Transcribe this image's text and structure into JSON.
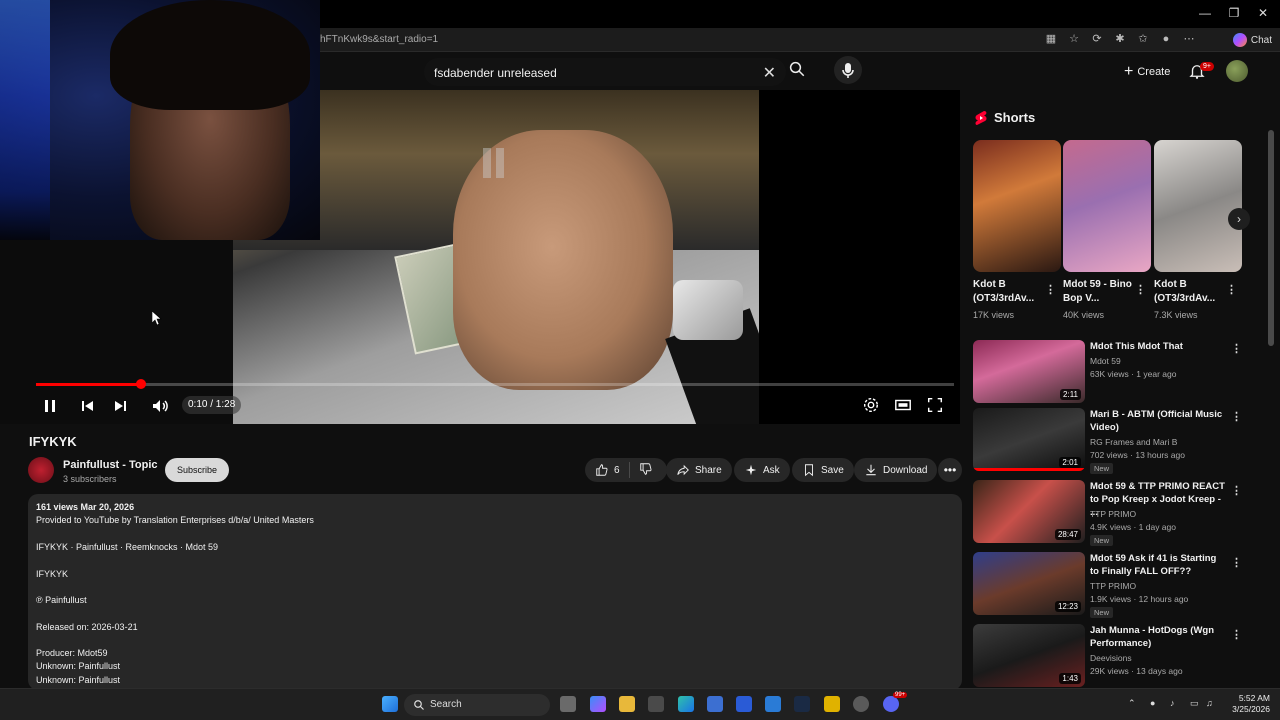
{
  "browser": {
    "url": "hFTnKwk9s&start_radio=1",
    "chat_label": "Chat"
  },
  "topbar": {
    "search_value": "fsdabender unreleased",
    "create_label": "Create",
    "notif_count": "9+"
  },
  "player": {
    "time": "0:10 / 1:28",
    "progress": 0.114
  },
  "video": {
    "title": "IFYKYK",
    "channel": "Painfullust - Topic",
    "subs": "3 subscribers",
    "subscribe": "Subscribe",
    "likes": "6",
    "share": "Share",
    "ask": "Ask",
    "save": "Save",
    "download": "Download"
  },
  "description": {
    "stats": "161 views  Mar 20, 2026",
    "lines": [
      "Provided to YouTube by Translation Enterprises d/b/a/ United Masters",
      "IFYKYK · Painfullust · Reemknocks · Mdot 59",
      "IFYKYK",
      "℗ Painfullust",
      "Released on: 2026-03-21",
      "Producer: Mdot59",
      "Unknown: Painfullust",
      "Unknown: Painfullust"
    ]
  },
  "shorts": {
    "heading": "Shorts",
    "items": [
      {
        "title": "Kdot B (OT3/3rdAv...",
        "views": "17K views"
      },
      {
        "title": "Mdot 59 - Bino Bop V...",
        "views": "40K views"
      },
      {
        "title": "Kdot B (OT3/3rdAv...",
        "views": "7.3K views"
      }
    ]
  },
  "recommended": [
    {
      "title": "Mdot This Mdot That",
      "channel": "Mdot 59",
      "meta": "63K views · 1 year ago",
      "duration": "2:11",
      "new": ""
    },
    {
      "title": "Mari B - ABTM (Official Music Video)",
      "channel": "RG Frames and Mari B",
      "meta": "702 views · 13 hours ago",
      "duration": "2:01",
      "new": "New"
    },
    {
      "title": "Mdot 59 & TTP PRIMO REACT to Pop Kreep x Jodot Kreep - ...",
      "channel": "TTP PRIMO",
      "meta": "4.9K views · 1 day ago",
      "duration": "28:47",
      "new": "New"
    },
    {
      "title": "Mdot 59 Ask if 41 is Starting to Finally FALL OFF??",
      "channel": "TTP PRIMO",
      "meta": "1.9K views · 12 hours ago",
      "duration": "12:23",
      "new": "New"
    },
    {
      "title": "Jah Munna - HotDogs (Wgn Performance)",
      "channel": "Deevisions",
      "meta": "29K views · 13 days ago",
      "duration": "1:43",
      "new": ""
    }
  ],
  "taskbar": {
    "search_label": "Search",
    "time": "5:52 AM",
    "date": "3/25/2026",
    "badge": "99+"
  },
  "colors": {
    "accent_red": "#ff0000",
    "background": "#0f0f0f",
    "surface": "#272727"
  }
}
